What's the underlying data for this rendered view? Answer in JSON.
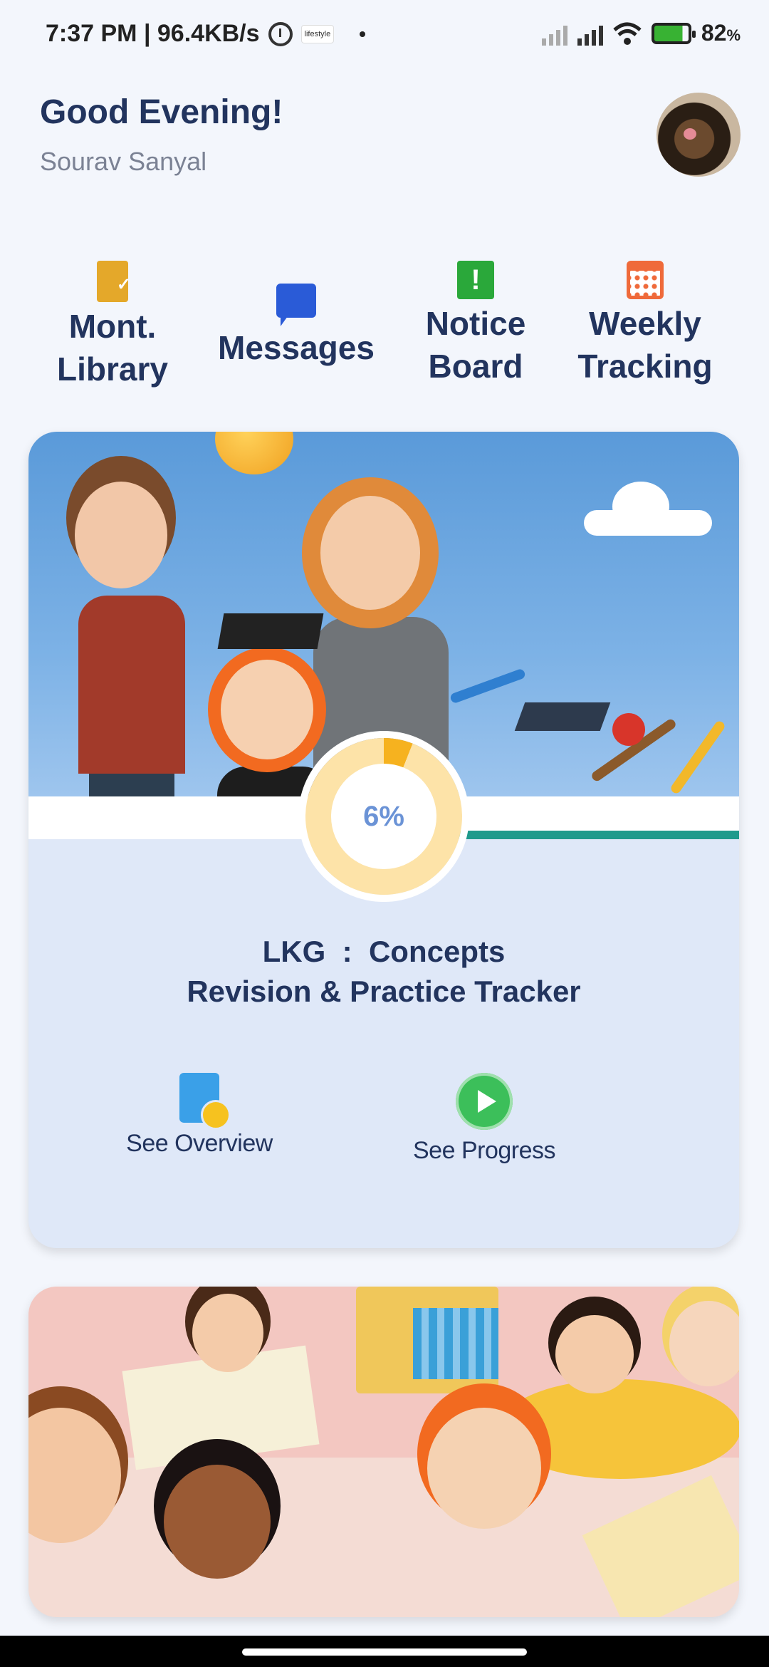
{
  "status_bar": {
    "time_speed": "7:37 PM | 96.4KB/s",
    "notification_app": "lifestyle",
    "battery_percent": "82",
    "battery_unit": "%"
  },
  "header": {
    "greeting": "Good Evening!",
    "user_name": "Sourav  Sanyal"
  },
  "shortcuts": [
    {
      "label_line1": "Mont.",
      "label_line2": "Library",
      "icon": "library-icon",
      "color": "#e4a82a"
    },
    {
      "label_line1": "Messages",
      "label_line2": "",
      "icon": "message-icon",
      "color": "#2a5bd7"
    },
    {
      "label_line1": "Notice",
      "label_line2": "Board",
      "icon": "notice-icon",
      "color": "#2aa83a"
    },
    {
      "label_line1": "Weekly",
      "label_line2": "Tracking",
      "icon": "calendar-icon",
      "color": "#ef6a3a"
    }
  ],
  "course_card": {
    "progress_text": "6%",
    "progress_fraction": 0.06,
    "title_line1": "LKG  :  Concepts",
    "title_line2": "Revision & Practice Tracker",
    "overview_label": "See Overview",
    "progress_label": "See Progress"
  },
  "colors": {
    "text_primary": "#22345e",
    "text_secondary": "#7b8294",
    "card_bg": "#dfe8f8",
    "progress_accent": "#f6b21f"
  }
}
